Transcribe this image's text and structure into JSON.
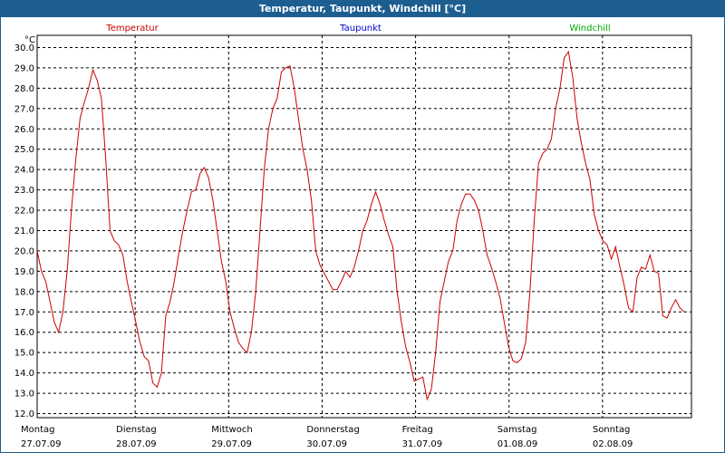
{
  "window": {
    "title": "Temperatur, Taupunkt, Windchill [°C]"
  },
  "chart_data": {
    "type": "line",
    "title": "Temperatur, Taupunkt, Windchill [°C]",
    "ylabel": "°C",
    "xlabel": "",
    "ylim": [
      11.8,
      30.6
    ],
    "yticks": [
      12.0,
      13.0,
      14.0,
      15.0,
      16.0,
      17.0,
      18.0,
      19.0,
      20.0,
      21.0,
      22.0,
      23.0,
      24.0,
      25.0,
      26.0,
      27.0,
      28.0,
      29.0,
      30.0
    ],
    "xlim": [
      0,
      6.75
    ],
    "grid": true,
    "day_labels": [
      {
        "day": "Montag",
        "date": "27.07.09"
      },
      {
        "day": "Dienstag",
        "date": "28.07.09"
      },
      {
        "day": "Mittwoch",
        "date": "29.07.09"
      },
      {
        "day": "Donnerstag",
        "date": "30.07.09"
      },
      {
        "day": "Freitag",
        "date": "31.07.09"
      },
      {
        "day": "Samstag",
        "date": "01.08.09"
      },
      {
        "day": "Sonntag",
        "date": "02.08.09"
      }
    ],
    "legend": [
      {
        "name": "Temperatur",
        "color": "#cc0000"
      },
      {
        "name": "Taupunkt",
        "color": "#0000cc"
      },
      {
        "name": "Windchill",
        "color": "#00aa00"
      }
    ],
    "series": [
      {
        "name": "Temperatur",
        "color": "#cc0000",
        "points": [
          [
            0.0,
            20.0
          ],
          [
            0.05,
            19.0
          ],
          [
            0.1,
            18.5
          ],
          [
            0.15,
            17.5
          ],
          [
            0.2,
            16.5
          ],
          [
            0.25,
            16.0
          ],
          [
            0.3,
            17.0
          ],
          [
            0.35,
            19.0
          ],
          [
            0.4,
            22.0
          ],
          [
            0.45,
            24.5
          ],
          [
            0.5,
            26.5
          ],
          [
            0.55,
            27.3
          ],
          [
            0.6,
            28.0
          ],
          [
            0.65,
            28.9
          ],
          [
            0.7,
            28.4
          ],
          [
            0.75,
            27.5
          ],
          [
            0.8,
            24.5
          ],
          [
            0.85,
            21.0
          ],
          [
            0.9,
            20.5
          ],
          [
            0.95,
            20.3
          ],
          [
            1.0,
            19.8
          ],
          [
            1.05,
            18.5
          ],
          [
            1.1,
            17.5
          ],
          [
            1.15,
            16.5
          ],
          [
            1.2,
            15.5
          ],
          [
            1.25,
            14.8
          ],
          [
            1.3,
            14.6
          ],
          [
            1.35,
            13.5
          ],
          [
            1.4,
            13.3
          ],
          [
            1.45,
            14.0
          ],
          [
            1.5,
            16.8
          ],
          [
            1.55,
            17.5
          ],
          [
            1.6,
            18.5
          ],
          [
            1.65,
            19.8
          ],
          [
            1.7,
            21.0
          ],
          [
            1.75,
            22.0
          ],
          [
            1.8,
            22.9
          ],
          [
            1.85,
            23.0
          ],
          [
            1.9,
            23.8
          ],
          [
            1.95,
            24.1
          ],
          [
            2.0,
            23.6
          ],
          [
            2.05,
            22.5
          ],
          [
            2.1,
            21.0
          ],
          [
            2.15,
            19.5
          ],
          [
            2.2,
            18.5
          ],
          [
            2.25,
            17.0
          ],
          [
            2.3,
            16.2
          ],
          [
            2.35,
            15.5
          ],
          [
            2.4,
            15.2
          ],
          [
            2.45,
            15.0
          ],
          [
            2.5,
            16.0
          ],
          [
            2.55,
            18.0
          ],
          [
            2.6,
            21.0
          ],
          [
            2.65,
            24.0
          ],
          [
            2.7,
            26.0
          ],
          [
            2.75,
            27.0
          ],
          [
            2.8,
            27.5
          ],
          [
            2.85,
            28.8
          ],
          [
            2.9,
            29.0
          ],
          [
            2.95,
            29.1
          ],
          [
            3.0,
            28.0
          ],
          [
            3.05,
            26.5
          ],
          [
            3.1,
            25.0
          ],
          [
            3.15,
            24.0
          ],
          [
            3.2,
            22.5
          ],
          [
            3.25,
            20.0
          ],
          [
            3.3,
            19.3
          ],
          [
            3.35,
            18.9
          ],
          [
            3.4,
            18.5
          ],
          [
            3.45,
            18.1
          ],
          [
            3.5,
            18.1
          ],
          [
            3.55,
            18.5
          ],
          [
            3.6,
            19.0
          ],
          [
            3.65,
            18.7
          ],
          [
            3.7,
            19.2
          ],
          [
            3.75,
            20.0
          ],
          [
            3.8,
            21.0
          ],
          [
            3.85,
            21.5
          ],
          [
            3.9,
            22.3
          ],
          [
            3.95,
            22.9
          ],
          [
            4.0,
            22.3
          ],
          [
            4.05,
            21.5
          ],
          [
            4.1,
            20.8
          ],
          [
            4.15,
            20.2
          ],
          [
            4.2,
            18.0
          ],
          [
            4.25,
            16.5
          ],
          [
            4.3,
            15.3
          ],
          [
            4.35,
            14.5
          ],
          [
            4.4,
            13.6
          ],
          [
            4.45,
            13.7
          ],
          [
            4.5,
            13.8
          ],
          [
            4.55,
            12.7
          ],
          [
            4.6,
            13.2
          ],
          [
            4.65,
            15.0
          ],
          [
            4.7,
            17.5
          ],
          [
            4.75,
            18.5
          ],
          [
            4.8,
            19.5
          ],
          [
            4.85,
            20.0
          ],
          [
            4.9,
            21.5
          ],
          [
            4.95,
            22.3
          ],
          [
            5.0,
            22.8
          ],
          [
            5.05,
            22.8
          ],
          [
            5.1,
            22.5
          ],
          [
            5.15,
            22.0
          ],
          [
            5.2,
            21.0
          ],
          [
            5.25,
            19.8
          ],
          [
            5.3,
            19.2
          ],
          [
            5.35,
            18.5
          ],
          [
            5.4,
            17.7
          ],
          [
            5.45,
            16.5
          ],
          [
            5.5,
            15.3
          ],
          [
            5.55,
            14.6
          ],
          [
            5.6,
            14.5
          ],
          [
            5.65,
            14.7
          ],
          [
            5.7,
            15.5
          ],
          [
            5.75,
            18.0
          ],
          [
            5.8,
            21.5
          ],
          [
            5.85,
            24.3
          ],
          [
            5.9,
            24.8
          ],
          [
            5.95,
            25.0
          ],
          [
            6.0,
            25.5
          ],
          [
            6.05,
            27.0
          ],
          [
            6.1,
            28.0
          ],
          [
            6.15,
            29.5
          ],
          [
            6.2,
            29.8
          ],
          [
            6.25,
            28.5
          ],
          [
            6.3,
            26.5
          ],
          [
            6.35,
            25.3
          ],
          [
            6.4,
            24.3
          ],
          [
            6.45,
            23.5
          ],
          [
            6.5,
            21.8
          ],
          [
            6.55,
            21.0
          ],
          [
            6.6,
            20.5
          ],
          [
            6.65,
            20.3
          ],
          [
            6.7,
            19.6
          ],
          [
            6.75,
            20.2
          ],
          [
            6.8,
            19.2
          ],
          [
            6.85,
            18.3
          ],
          [
            6.9,
            17.2
          ],
          [
            6.95,
            17.0
          ],
          [
            7.0,
            18.7
          ],
          [
            7.05,
            19.2
          ],
          [
            7.1,
            19.1
          ],
          [
            7.15,
            19.8
          ],
          [
            7.2,
            19.0
          ],
          [
            7.25,
            18.9
          ],
          [
            7.3,
            16.8
          ],
          [
            7.35,
            16.7
          ],
          [
            7.4,
            17.2
          ],
          [
            7.45,
            17.6
          ],
          [
            7.5,
            17.2
          ],
          [
            7.55,
            17.0
          ]
        ]
      }
    ]
  }
}
